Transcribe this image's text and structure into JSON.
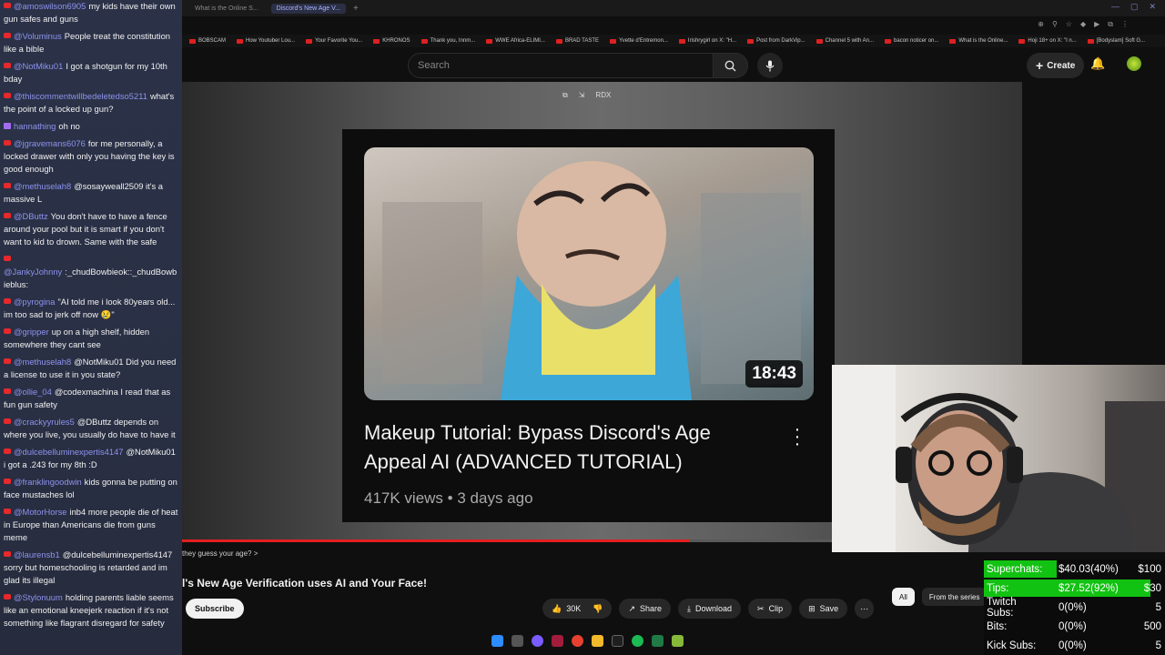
{
  "browser": {
    "tabs": [
      {
        "label": "What is the Online S..."
      },
      {
        "label": "Discord's New Age V..."
      }
    ],
    "bookmarks": [
      "BOBSCAM",
      "How Youtuber Lou...",
      "Your Favorite You...",
      "KHRONOS",
      "Thank you, Innm...",
      "WWE Africa-ELIMI...",
      "BRAD TASTE",
      "Yvette d'Entremon...",
      "Irishrygirl on X: \"H...",
      "Post from DarkVip...",
      "Channel 5 with An...",
      "bacon noticer on...",
      "What is the Online...",
      "Hoji 18+ on X: \"I n...",
      "[Bodyslam] Soft G..."
    ]
  },
  "youtube": {
    "search_placeholder": "Search",
    "create_label": "Create",
    "video": {
      "duration": "18:43",
      "title": "Makeup Tutorial: Bypass Discord's Age Appeal AI (ADVANCED TUTORIAL)",
      "views": "417K views",
      "age": "3 days ago",
      "progress": 0.78
    },
    "player_caption": "they guess your age? >",
    "page_title": "l's New Age Verification uses AI and Your Face!",
    "subscribe_label": "Subscribe",
    "likes": "30K",
    "share_label": "Share",
    "download_label": "Download",
    "clip_label": "Clip",
    "save_label": "Save",
    "chip_all": "All",
    "chip_series": "From the series"
  },
  "chat": [
    {
      "src": "yt",
      "user": "@amoswilson6905",
      "text": "my kids have their own gun safes and guns"
    },
    {
      "src": "yt",
      "user": "@Voluminus",
      "text": "People treat the constitution like a bible"
    },
    {
      "src": "yt",
      "user": "@NotMiku01",
      "text": "I got a shotgun for my 10th bday"
    },
    {
      "src": "yt",
      "user": "@thiscommentwillbedeletedso5211",
      "text": "what's the point of a locked up gun?"
    },
    {
      "src": "tw",
      "user": "hannathing",
      "text": "oh no"
    },
    {
      "src": "yt",
      "user": "@jgravemans6076",
      "text": "for me personally, a locked drawer with only you having the key is good enough"
    },
    {
      "src": "yt",
      "user": "@methuselah8",
      "text": "@sosayweall2509 it's a massive L"
    },
    {
      "src": "yt",
      "user": "@DButtz",
      "text": "You don't have to have a fence around your pool but it is smart if you don't want to kid to drown. Same with the safe"
    },
    {
      "src": "yt",
      "user": "@JankyJohnny",
      "text": ":_chudBowbieok::_chudBowbieblus:"
    },
    {
      "src": "yt",
      "user": "@pyrogina",
      "text": "\"AI told me i look 80years old... im too sad to jerk off now 😢\""
    },
    {
      "src": "yt",
      "user": "@gripper",
      "text": "up on a high shelf, hidden somewhere they cant see"
    },
    {
      "src": "yt",
      "user": "@methuselah8",
      "text": "@NotMiku01 Did you need a license to use it in you state?"
    },
    {
      "src": "yt",
      "user": "@ollie_04",
      "text": "@codexmachina I read that as fun gun safety"
    },
    {
      "src": "yt",
      "user": "@crackyyrules5",
      "text": "@DButtz depends on where you live, you usually do have to have it"
    },
    {
      "src": "yt",
      "user": "@dulcebelluminexpertis4147",
      "text": "@NotMiku01 i got a .243 for my 8th :D"
    },
    {
      "src": "yt",
      "user": "@franklingoodwin",
      "text": "kids gonna be putting on face mustaches lol"
    },
    {
      "src": "yt",
      "user": "@MotorHorse",
      "text": "inb4 more people die of heat in Europe than Americans die from guns meme"
    },
    {
      "src": "yt",
      "user": "@laurensb1",
      "text": "@dulcebelluminexpertis4147 sorry but homeschooling is retarded and im glad its illegal"
    },
    {
      "src": "yt",
      "user": "@Stylonuum",
      "text": "holding parents liable seems like an emotional kneejerk reaction if it's not something like flagrant disregard for safety"
    }
  ],
  "stats": [
    {
      "label": "Superchats:",
      "value": "$40.03(40%)",
      "goal": "$100",
      "fill": 0.4
    },
    {
      "label": "Tips:",
      "value": "$27.52(92%)",
      "goal": "$30",
      "fill": 0.92
    },
    {
      "label": "Twitch Subs:",
      "value": "0(0%)",
      "goal": "5",
      "fill": 0
    },
    {
      "label": "Bits:",
      "value": "0(0%)",
      "goal": "500",
      "fill": 0
    },
    {
      "label": "Kick Subs:",
      "value": "0(0%)",
      "goal": "5",
      "fill": 0
    }
  ],
  "colors": {
    "accent_red": "#e21f1f",
    "goal_green": "#12c212",
    "chat_user": "#8d93ee"
  }
}
